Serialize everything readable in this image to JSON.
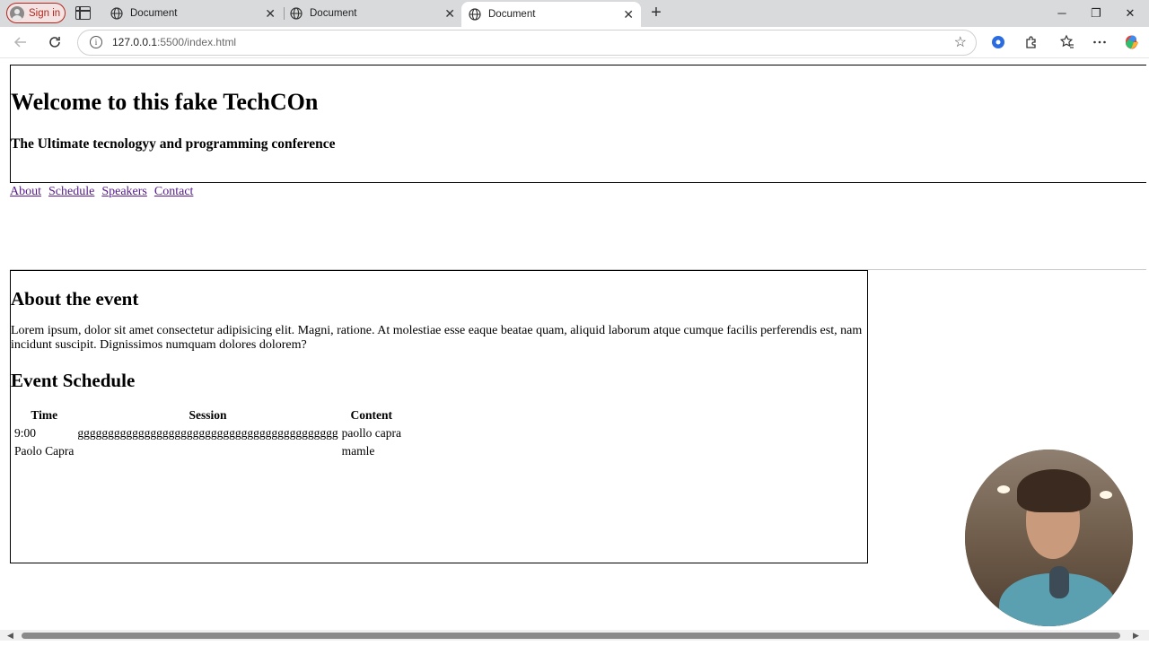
{
  "browser": {
    "sign_in_label": "Sign in",
    "tabs": [
      {
        "title": "Document",
        "close": "✕"
      },
      {
        "title": "Document",
        "close": "✕"
      },
      {
        "title": "Document",
        "close": "✕"
      }
    ],
    "new_tab": "+",
    "window_controls": {
      "minimize": "─",
      "maximize": "❐",
      "close": "✕"
    },
    "url_host": "127.0.0.1",
    "url_rest": ":5500/index.html",
    "icons": {
      "back": "back-arrow-icon",
      "reload": "reload-icon",
      "info": "info-icon",
      "favorite": "star-icon",
      "more": "more-icon"
    },
    "accent_colors": {
      "sign_in": "#b3261e",
      "link_visited": "#551a8b"
    }
  },
  "page": {
    "header": {
      "title": "Welcome to this fake TechCOn",
      "subtitle": "The Ultimate tecnologyy and programming conference"
    },
    "nav": [
      "About",
      "Schedule",
      "Speakers",
      "Contact"
    ],
    "about": {
      "heading": "About the event",
      "body": "Lorem ipsum, dolor sit amet consectetur adipisicing elit. Magni, ratione. At molestiae esse eaque beatae quam, aliquid laborum atque cumque facilis perferendis est, nam incidunt suscipit. Dignissimos numquam dolores dolorem?"
    },
    "schedule": {
      "heading": "Event Schedule",
      "columns": [
        "Time",
        "Session",
        "Content"
      ],
      "rows": [
        [
          "9:00",
          "ggggggggggggggggggggggggggggggggggggggggggg",
          "paollo capra"
        ],
        [
          "Paolo Capra",
          "",
          "mamle"
        ]
      ]
    }
  }
}
